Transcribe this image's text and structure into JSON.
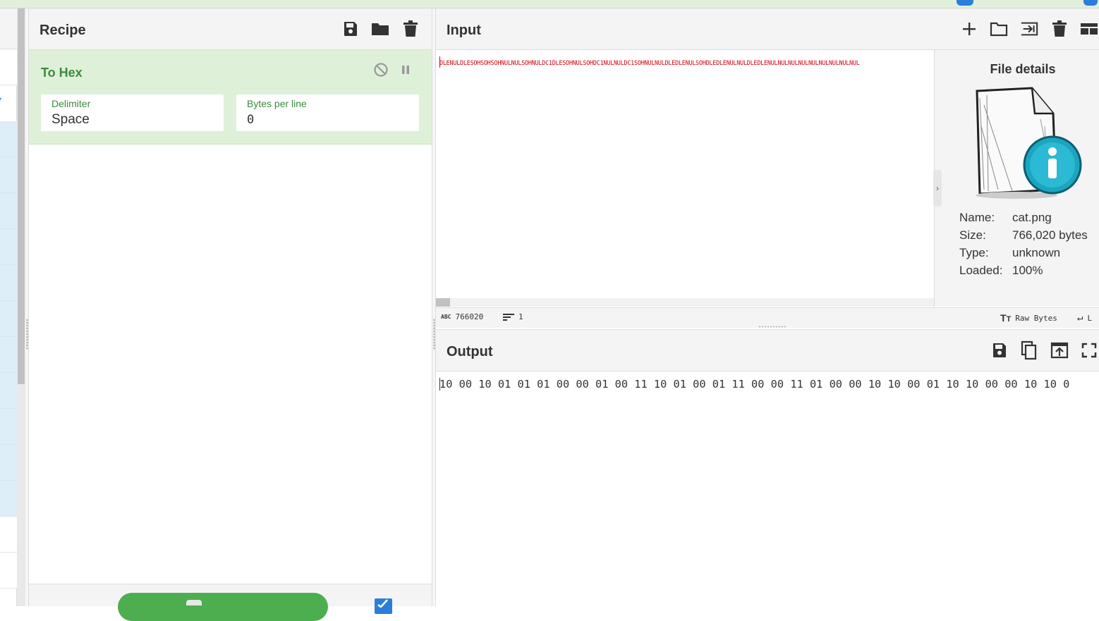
{
  "recipe": {
    "title": "Recipe",
    "operation": {
      "name": "To Hex",
      "delimiter_label": "Delimiter",
      "delimiter_value": "Space",
      "bytes_per_line_label": "Bytes per line",
      "bytes_per_line_value": "0"
    }
  },
  "input": {
    "title": "Input",
    "text": "DLENULDLESOHSOHSOHNULNULSOHNULDC1DLESOHNULSOHDC1NULNULDC1SOHNULNULDLEDLENULSOHDLEDLENULNULDLEDLENULNULNULNULNULNULNULNULNUL",
    "file_details": {
      "title": "File details",
      "name_label": "Name:",
      "name_value": "cat.png",
      "size_label": "Size:",
      "size_value": "766,020 bytes",
      "type_label": "Type:",
      "type_value": "unknown",
      "loaded_label": "Loaded:",
      "loaded_value": "100%"
    },
    "status": {
      "length": "766020",
      "lines": "1",
      "encoding": "Raw Bytes",
      "eol_abbrev": "L"
    }
  },
  "output": {
    "title": "Output",
    "text": "10 00 10 01 01 01 00 00 01 00 11 10 01 00 01 11 00 00 11 01 00 00 10 10 00 01 10 10 00 00 10 10 0"
  },
  "colors": {
    "accent_green": "#3c8a3f",
    "op_background": "#dff0d8",
    "bake_button": "#4cae4f",
    "input_text": "#d4000f",
    "link_blue": "#2b7fd8"
  },
  "icons": {
    "recipe_toolbar": [
      "save-icon",
      "folder-icon",
      "trash-icon"
    ],
    "operation_controls": [
      "disable-icon",
      "pause-icon"
    ],
    "input_toolbar": [
      "plus-icon",
      "folder-open-icon",
      "input-tab-icon",
      "trash-icon",
      "layout-icon"
    ],
    "output_toolbar": [
      "save-icon",
      "copy-icon",
      "replace-input-icon",
      "maximise-icon"
    ],
    "status": [
      "abc-icon",
      "lines-icon",
      "font-size-icon",
      "return-icon"
    ]
  }
}
